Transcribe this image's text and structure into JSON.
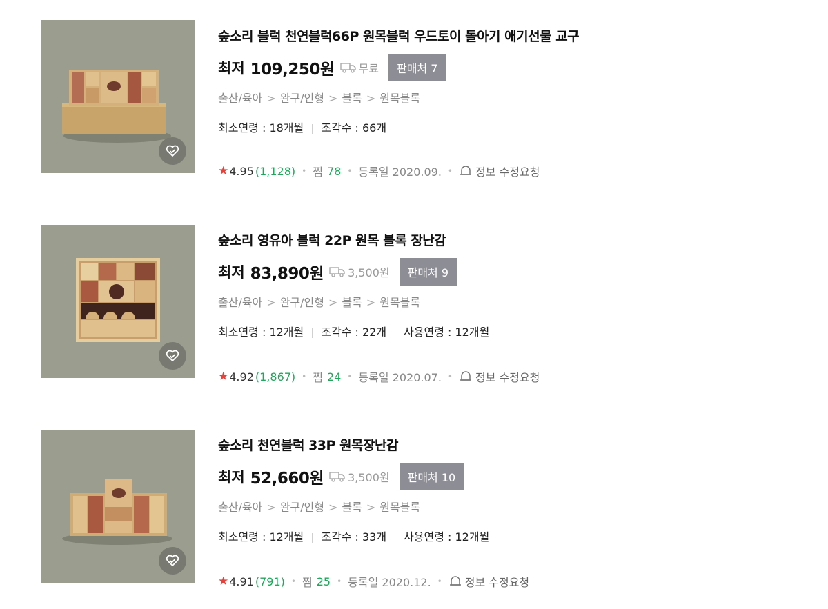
{
  "items": [
    {
      "title": "숲소리 블럭 천연블럭66P 원목블럭 우드토이 돌아기 애기선물 교구",
      "price_label": "최저",
      "price": "109,250원",
      "shipping": "무료",
      "sellers": "판매처 7",
      "category": [
        "출산/육아",
        "완구/인형",
        "블록",
        "원목블록"
      ],
      "specs": [
        "최소연령 : 18개월",
        "조각수 : 66개"
      ],
      "rating": "4.95",
      "review_count": "(1,128)",
      "zzim_label": "찜",
      "zzim_count": "78",
      "registered": "등록일 2020.09.",
      "report": "정보 수정요청"
    },
    {
      "title": "숲소리 영유아 블럭 22P 원목 블록 장난감",
      "price_label": "최저",
      "price": "83,890원",
      "shipping": "3,500원",
      "sellers": "판매처 9",
      "category": [
        "출산/육아",
        "완구/인형",
        "블록",
        "원목블록"
      ],
      "specs": [
        "최소연령 : 12개월",
        "조각수 : 22개",
        "사용연령 : 12개월"
      ],
      "rating": "4.92",
      "review_count": "(1,867)",
      "zzim_label": "찜",
      "zzim_count": "24",
      "registered": "등록일 2020.07.",
      "report": "정보 수정요청"
    },
    {
      "title": "숲소리 천연블럭 33P 원목장난감",
      "price_label": "최저",
      "price": "52,660원",
      "shipping": "3,500원",
      "sellers": "판매처 10",
      "category": [
        "출산/육아",
        "완구/인형",
        "블록",
        "원목블록"
      ],
      "specs": [
        "최소연령 : 12개월",
        "조각수 : 33개",
        "사용연령 : 12개월"
      ],
      "rating": "4.91",
      "review_count": "(791)",
      "zzim_label": "찜",
      "zzim_count": "25",
      "registered": "등록일 2020.12.",
      "report": "정보 수정요청"
    }
  ],
  "colors": {
    "thumb_bg": "#9a9d8d",
    "seller_badge": "#8d8d95",
    "review_green": "#1fa85a",
    "star_red": "#e8403a"
  }
}
